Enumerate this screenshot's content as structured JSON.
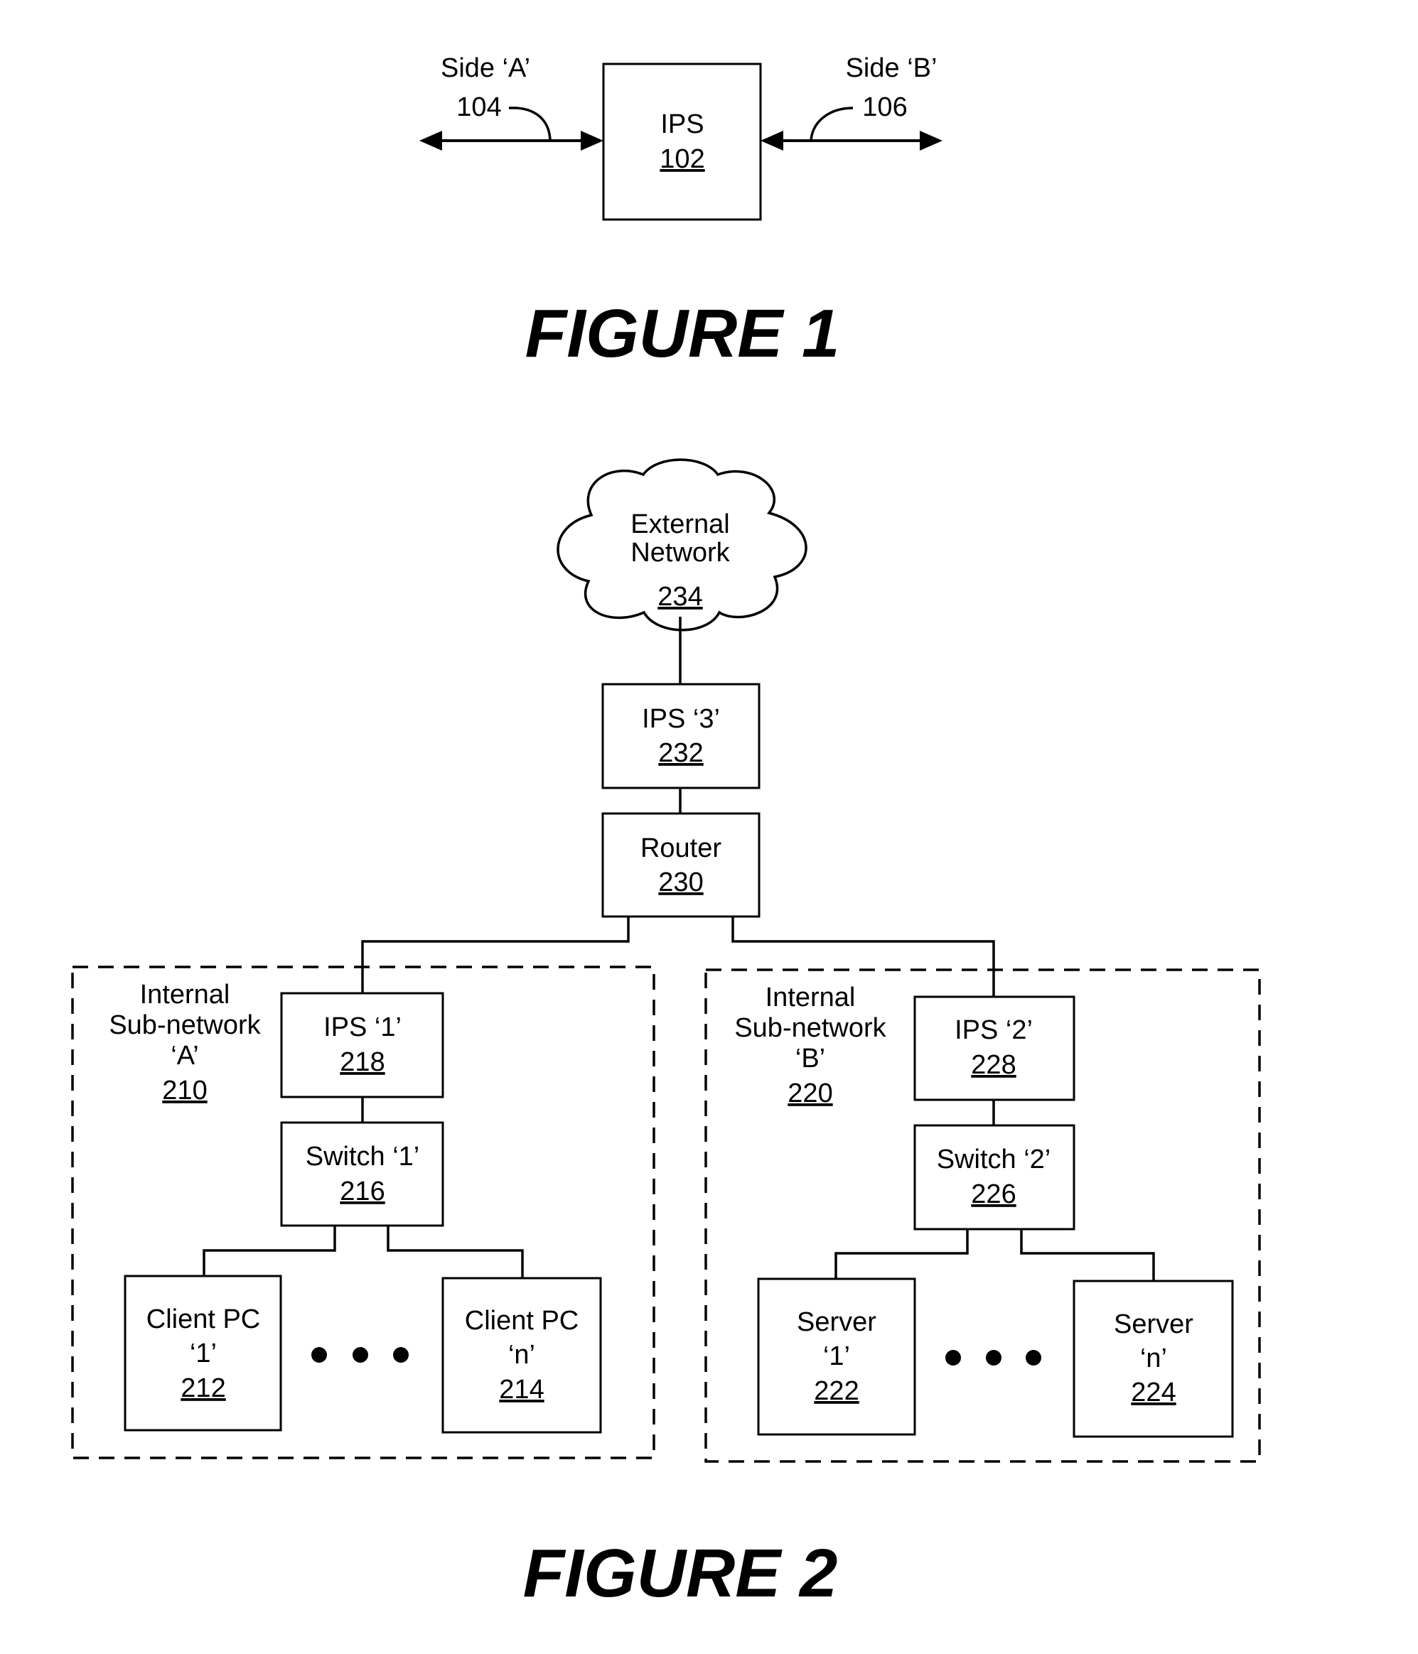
{
  "figure1": {
    "caption": "FIGURE 1",
    "ips": {
      "label": "IPS",
      "ref": "102"
    },
    "side_a": {
      "label": "Side ‘A’",
      "ref": "104"
    },
    "side_b": {
      "label": "Side ‘B’",
      "ref": "106"
    }
  },
  "figure2": {
    "caption": "FIGURE 2",
    "external_network": {
      "line1": "External",
      "line2": "Network",
      "ref": "234"
    },
    "ips3": {
      "label": "IPS ‘3’",
      "ref": "232"
    },
    "router": {
      "label": "Router",
      "ref": "230"
    },
    "subnet_a": {
      "line1": "Internal",
      "line2": "Sub-network",
      "line3": "‘A’",
      "ref": "210",
      "ips": {
        "label": "IPS ‘1’",
        "ref": "218"
      },
      "switch": {
        "label": "Switch ‘1’",
        "ref": "216"
      },
      "node_first": {
        "line1": "Client PC",
        "line2": "‘1’",
        "ref": "212"
      },
      "node_last": {
        "line1": "Client PC",
        "line2": "‘n’",
        "ref": "214"
      }
    },
    "subnet_b": {
      "line1": "Internal",
      "line2": "Sub-network",
      "line3": "‘B’",
      "ref": "220",
      "ips": {
        "label": "IPS ‘2’",
        "ref": "228"
      },
      "switch": {
        "label": "Switch ‘2’",
        "ref": "226"
      },
      "node_first": {
        "line1": "Server",
        "line2": "‘1’",
        "ref": "222"
      },
      "node_last": {
        "line1": "Server",
        "line2": "‘n’",
        "ref": "224"
      }
    }
  }
}
